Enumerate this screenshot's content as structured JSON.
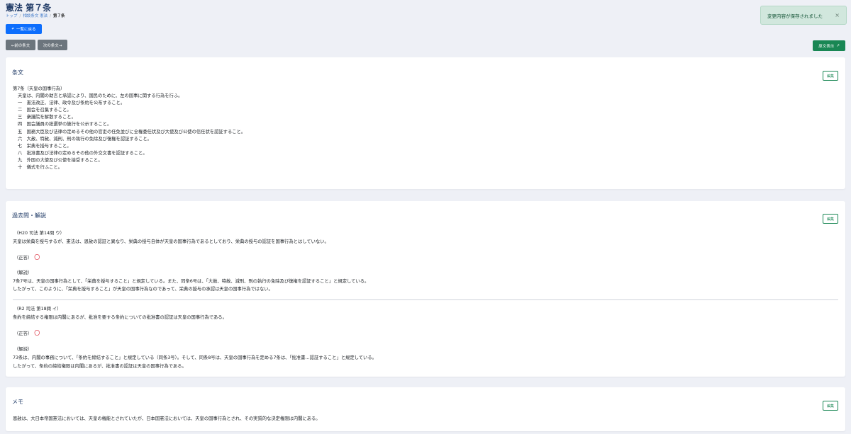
{
  "header": {
    "title": "憲法 第７条",
    "breadcrumb": [
      "トップ",
      "相談条文 憲法",
      "第７条"
    ],
    "back_button": "一覧に戻る",
    "back_icon": "↵",
    "prev_button": "←前の条文",
    "next_button": "次の条文→",
    "original_button": "原文表示",
    "original_icon": "↗"
  },
  "toast": {
    "message": "変更内容が保存されました",
    "close": "×"
  },
  "article": {
    "heading": "条文",
    "edit": "編集",
    "lines": [
      "第7条（天皇の国事行為）",
      "天皇は、内閣の助言と承認により、国民のために、左の国事に関する行為を行ふ。",
      "一　憲法改正、法律、政令及び条約を公布すること。",
      "二　国会を召集すること。",
      "三　衆議院を解散すること。",
      "四　国会議員の総選挙の施行を公示すること。",
      "五　国務大臣及び法律の定めるその他の官吏の任免並びに全権委任状及び大使及び公使の信任状を認証すること。",
      "六　大赦、特赦、減刑、刑の執行の免除及び復権を認証すること。",
      "七　栄典を授与すること。",
      "八　批准書及び法律の定めるその他の外交文書を認証すること。",
      "九　外国の大使及び公使を接受すること。",
      "十　儀式を行ふこと。"
    ]
  },
  "past": {
    "heading": "過去問・解説",
    "edit": "編集",
    "items": [
      {
        "source": "（H20 司法 第14問 ウ）",
        "question": "天皇は栄典を授与するが、憲法は、恩赦の認証と異なり、栄典の授与自体が天皇の国事行為であるとしており、栄典の授与の認証を国事行為とはしていない。",
        "answer_label": "（正答）",
        "answer": "〇",
        "explanation_label": "（解説）",
        "explanation": [
          "7条7号は、天皇の国事行為として、「栄典を授与すること」と規定している。また、同条6号は、「大赦、特赦、減刑、刑の執行の免除及び復権を認証すること」と規定している。",
          "したがって、このように、「栄典を授与すること」が天皇の国事行為なのであって、栄典の授与の承認は天皇の国事行為ではない。"
        ]
      },
      {
        "source": "（R2 司法 第18問 イ）",
        "question": "条約を締結する権限は内閣にあるが、批准を要する条約についての批准書の認証は天皇の国事行為である。",
        "answer_label": "（正答）",
        "answer": "〇",
        "explanation_label": "（解説）",
        "explanation": [
          "73条は、内閣の事務について、「条約を締結すること」と規定している（同条3号）。そして、同条8号は、天皇の国事行為を定める7条は、「批准書…認証すること」と規定している。",
          "したがって、条約の締結権限は内閣にあるが、批准書の認証は天皇の国事行為である。"
        ]
      }
    ]
  },
  "memo": {
    "heading": "メモ",
    "edit": "編集",
    "text": "恩赦は、大日本帝国憲法においては、天皇の権能とされていたが、日本国憲法においては、天皇の国事行為とされ、その実質的な決定権限は内閣にある。"
  },
  "colors": {
    "primary": "#0d6efd",
    "success": "#198754",
    "secondary": "#6c757d",
    "title": "#1f3a66",
    "maru": "#dc3545"
  }
}
